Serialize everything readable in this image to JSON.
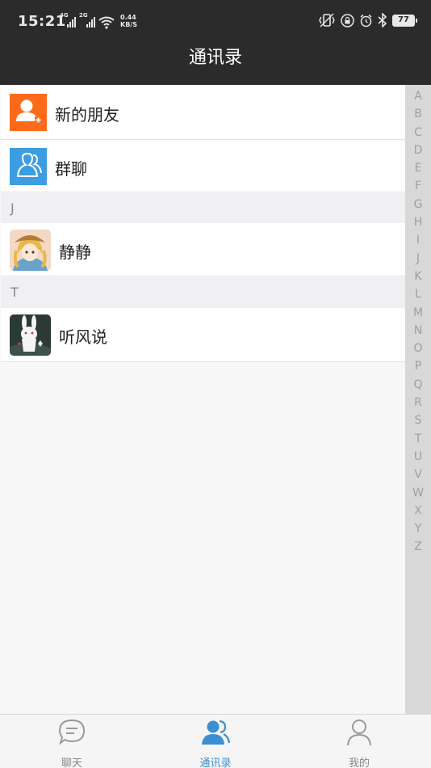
{
  "status_bar": {
    "time": "15:21",
    "net_4g": "4G",
    "net_2g": "2G",
    "speed_value": "0.44",
    "speed_unit": "KB/S",
    "battery": "77"
  },
  "header": {
    "title": "通讯录"
  },
  "top_items": [
    {
      "label": "新的朋友",
      "icon": "new-friend-icon",
      "color": "#ff6a1a"
    },
    {
      "label": "群聊",
      "icon": "group-chat-icon",
      "color": "#3c9ee0"
    }
  ],
  "sections": [
    {
      "letter": "J",
      "contacts": [
        {
          "name": "静静"
        }
      ]
    },
    {
      "letter": "T",
      "contacts": [
        {
          "name": "听风说"
        }
      ]
    }
  ],
  "index_letters": [
    "A",
    "B",
    "C",
    "D",
    "E",
    "F",
    "G",
    "H",
    "I",
    "J",
    "K",
    "L",
    "M",
    "N",
    "O",
    "P",
    "Q",
    "R",
    "S",
    "T",
    "U",
    "V",
    "W",
    "X",
    "Y",
    "Z"
  ],
  "tabs": [
    {
      "label": "聊天",
      "icon": "chat-icon",
      "active": false
    },
    {
      "label": "通讯录",
      "icon": "contacts-icon",
      "active": true
    },
    {
      "label": "我的",
      "icon": "profile-icon",
      "active": false
    }
  ],
  "colors": {
    "active": "#3c8fd0",
    "inactive": "#888888",
    "bar": "#2b2b2b"
  }
}
